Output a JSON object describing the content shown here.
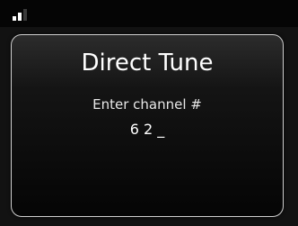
{
  "status_bar": {
    "signal_icon": "signal-strength-icon",
    "signal_bars_active": 2,
    "signal_bars_total": 3
  },
  "dialog": {
    "title": "Direct Tune",
    "prompt": "Enter channel #",
    "entry": "6 2 _"
  },
  "colors": {
    "background": "#000000",
    "dialog_border": "#cfcfcf",
    "text": "#ffffff"
  }
}
